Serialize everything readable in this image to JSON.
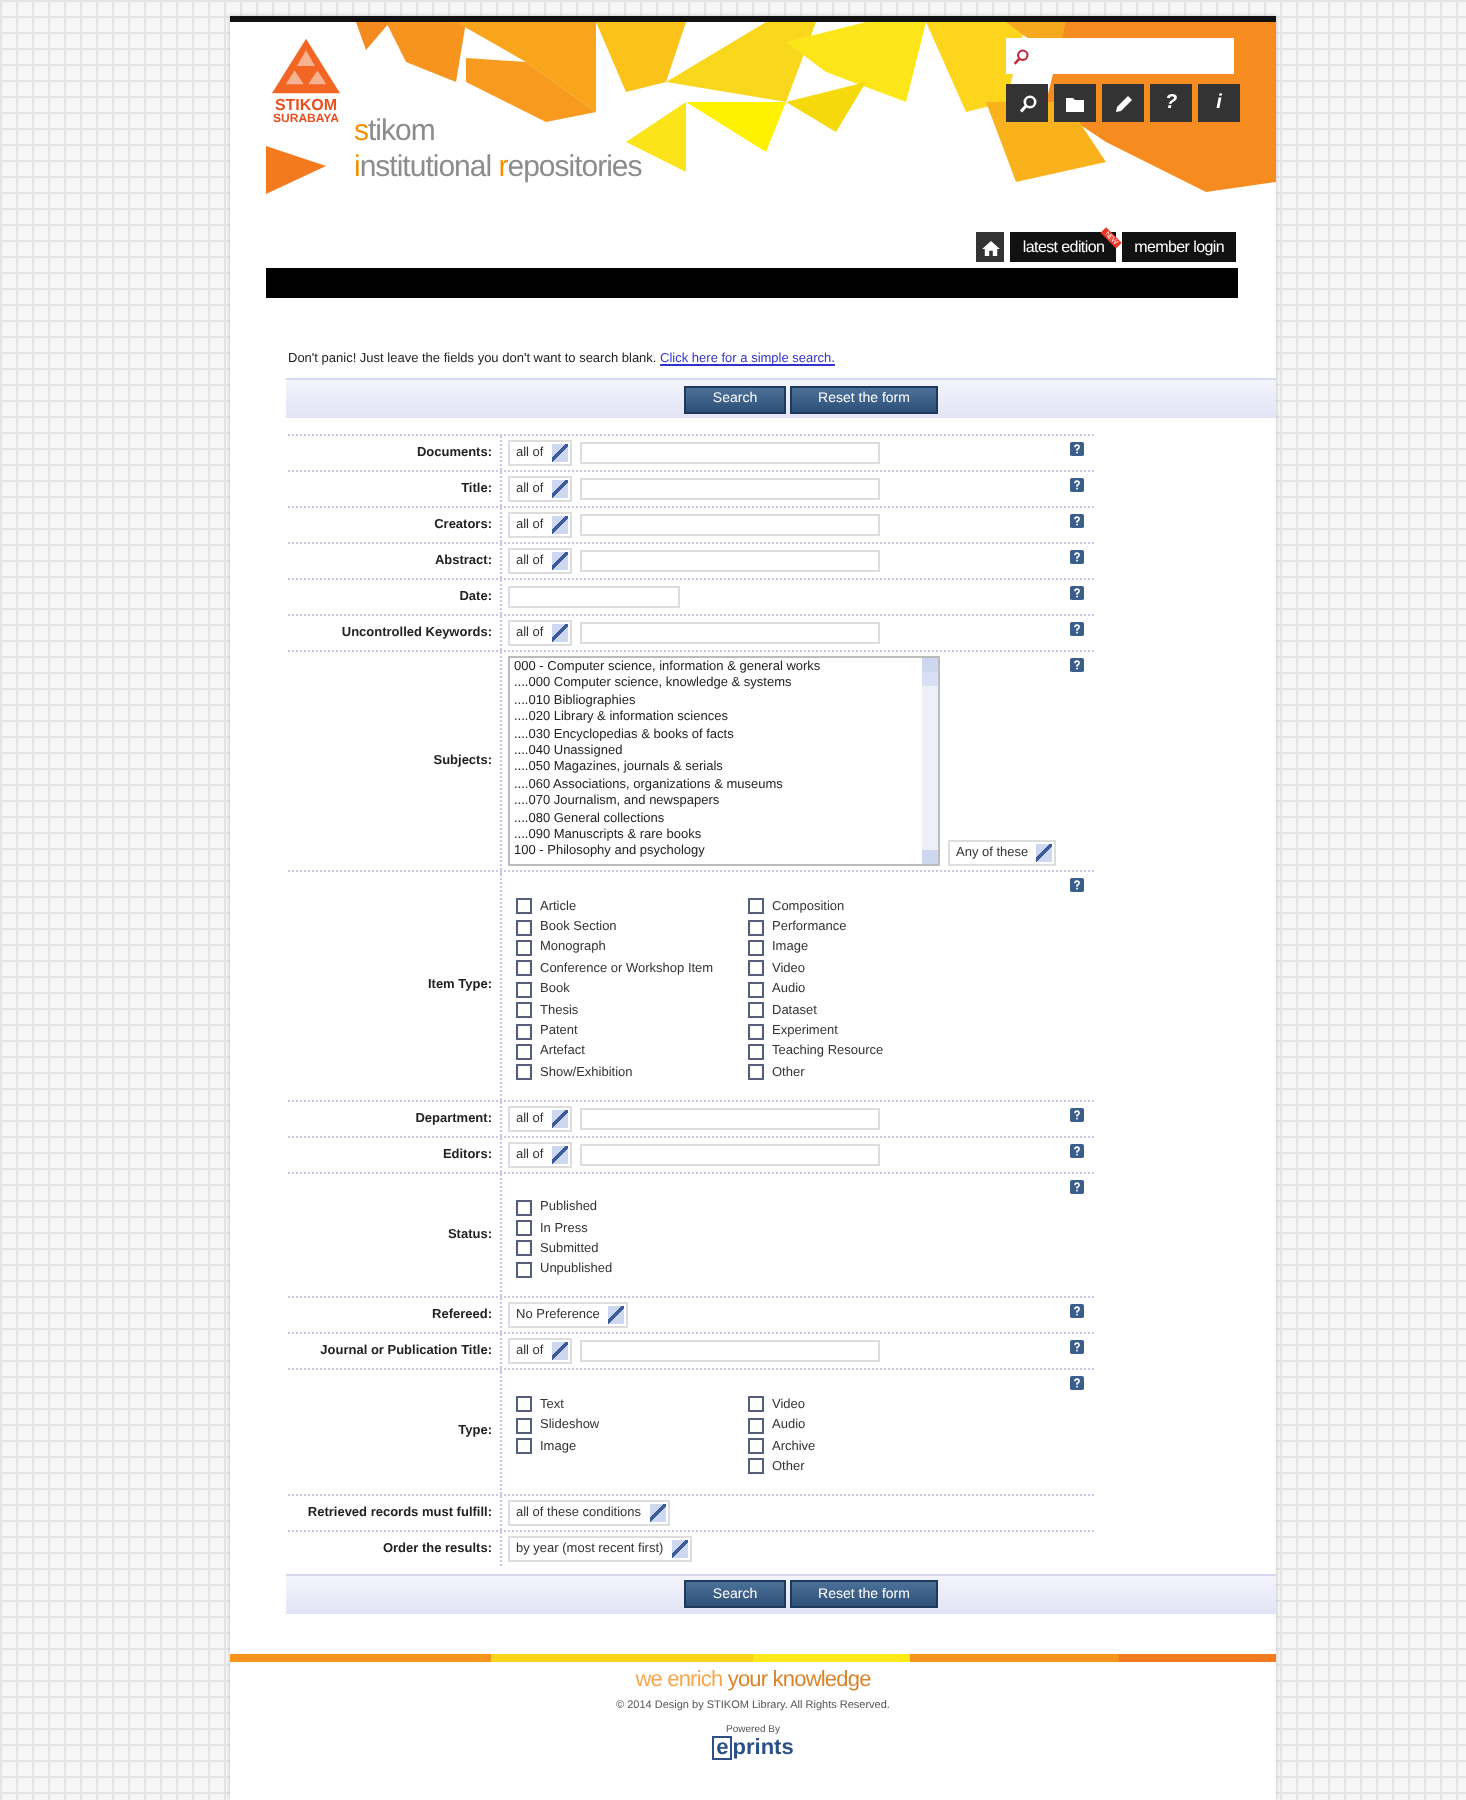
{
  "header": {
    "logo_lines": [
      "STIKOM",
      "SURABAYA"
    ],
    "title_lines": [
      [
        {
          "text": "s",
          "accent": true
        },
        {
          "text": "tikom",
          "accent": false
        }
      ],
      [
        {
          "text": "i",
          "accent": true
        },
        {
          "text": "nstitutional ",
          "accent": false
        },
        {
          "text": "r",
          "accent": true
        },
        {
          "text": "epositories",
          "accent": false
        }
      ]
    ],
    "tools": [
      {
        "kind": "search"
      },
      {
        "kind": "folder"
      },
      {
        "kind": "pencil"
      },
      {
        "kind": "char",
        "label": "?"
      },
      {
        "kind": "char",
        "label": "i"
      }
    ],
    "nav": [
      {
        "kind": "home"
      },
      {
        "kind": "link",
        "label": "latest edition",
        "badge": "NEW"
      },
      {
        "kind": "link",
        "label": "member login"
      }
    ]
  },
  "intro": {
    "text": "Don't panic! Just leave the fields you don't want to search blank.",
    "link": "Click here for a simple search."
  },
  "buttons_top": [
    "Search",
    "Reset the form"
  ],
  "fields": [
    {
      "kind": "text",
      "label": "Documents:",
      "match": "all of"
    },
    {
      "kind": "text",
      "label": "Title:",
      "match": "all of"
    },
    {
      "kind": "text",
      "label": "Creators:",
      "match": "all of"
    },
    {
      "kind": "text",
      "label": "Abstract:",
      "match": "all of"
    },
    {
      "kind": "date",
      "label": "Date:"
    },
    {
      "kind": "text",
      "label": "Uncontrolled Keywords:",
      "match": "all of"
    },
    {
      "kind": "subjects",
      "label": "Subjects:",
      "options": [
        "000 - Computer science, information & general works",
        "....000 Computer science, knowledge & systems",
        "....010 Bibliographies",
        "....020 Library & information sciences",
        "....030 Encyclopedias & books of facts",
        "....040 Unassigned",
        "....050 Magazines, journals & serials",
        "....060 Associations, organizations & museums",
        "....070 Journalism, and newspapers",
        "....080 General collections",
        "....090 Manuscripts & rare books",
        "100 - Philosophy and psychology"
      ],
      "match": "Any of these"
    },
    {
      "kind": "checkboxes",
      "label": "Item Type:",
      "columns": [
        [
          {
            "label": "Article",
            "checked": false
          },
          {
            "label": "Book Section",
            "checked": false
          },
          {
            "label": "Monograph",
            "checked": false
          },
          {
            "label": "Conference or Workshop Item",
            "checked": false
          },
          {
            "label": "Book",
            "checked": false
          },
          {
            "label": "Thesis",
            "checked": false
          },
          {
            "label": "Patent",
            "checked": false
          },
          {
            "label": "Artefact",
            "checked": false
          },
          {
            "label": "Show/Exhibition",
            "checked": false
          }
        ],
        [
          {
            "label": "Composition",
            "checked": false
          },
          {
            "label": "Performance",
            "checked": false
          },
          {
            "label": "Image",
            "checked": false
          },
          {
            "label": "Video",
            "checked": false
          },
          {
            "label": "Audio",
            "checked": false
          },
          {
            "label": "Dataset",
            "checked": false
          },
          {
            "label": "Experiment",
            "checked": false
          },
          {
            "label": "Teaching Resource",
            "checked": false
          },
          {
            "label": "Other",
            "checked": false
          }
        ]
      ]
    },
    {
      "kind": "text",
      "label": "Department:",
      "match": "all of"
    },
    {
      "kind": "text",
      "label": "Editors:",
      "match": "all of"
    },
    {
      "kind": "checkboxes",
      "label": "Status:",
      "columns": [
        [
          {
            "label": "Published",
            "checked": false
          },
          {
            "label": "In Press",
            "checked": false
          },
          {
            "label": "Submitted",
            "checked": false
          },
          {
            "label": "Unpublished",
            "checked": false
          }
        ]
      ]
    },
    {
      "kind": "select",
      "label": "Refereed:",
      "value": "No Preference"
    },
    {
      "kind": "text",
      "label": "Journal or Publication Title:",
      "match": "all of"
    },
    {
      "kind": "checkboxes",
      "label": "Type:",
      "columns": [
        [
          {
            "label": "Text",
            "checked": false
          },
          {
            "label": "Slideshow",
            "checked": false
          },
          {
            "label": "Image",
            "checked": false
          }
        ],
        [
          {
            "label": "Video",
            "checked": false
          },
          {
            "label": "Audio",
            "checked": false
          },
          {
            "label": "Archive",
            "checked": false
          },
          {
            "label": "Other",
            "checked": false
          }
        ]
      ]
    },
    {
      "kind": "select",
      "label": "Retrieved records must fulfill:",
      "value": "all of these conditions",
      "help": false
    },
    {
      "kind": "select",
      "label": "Order the results:",
      "value": "by year (most recent first)",
      "help": false
    }
  ],
  "buttons_bottom": [
    "Search",
    "Reset the form"
  ],
  "footer": {
    "tagline": [
      {
        "text": "we enrich ",
        "accent": true
      },
      {
        "text": "your knowledge",
        "accent": false
      }
    ],
    "copyright": "© 2014 Design by STIKOM Library. All Rights Reserved.",
    "powered": "Powered By",
    "logo": "eprints"
  }
}
